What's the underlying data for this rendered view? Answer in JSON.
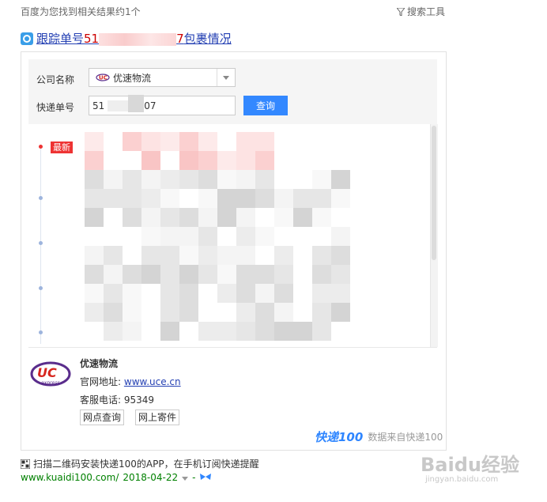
{
  "header": {
    "result_count": "百度为您找到相关结果约1个",
    "search_tools": "搜索工具"
  },
  "result": {
    "title_prefix": "跟踪单号",
    "title_number_start": "51",
    "title_number_end": "7",
    "title_suffix": "包裹情况"
  },
  "form": {
    "company_label": "公司名称",
    "company_value": "优速物流",
    "tracking_label": "快递单号",
    "tracking_start": "51",
    "tracking_end": "07",
    "query_button": "查询"
  },
  "timeline": {
    "latest_badge": "最新"
  },
  "company": {
    "name": "优速物流",
    "website_label": "官网地址:",
    "website": "www.uce.cn",
    "phone_label": "客服电话:",
    "phone": "95349",
    "branch_button": "网点查询",
    "ship_button": "网上寄件",
    "logo_text": "UC",
    "logo_sub": "express"
  },
  "footer": {
    "brand_logo": "快递100",
    "data_source": "数据来自快递100",
    "qr_tip": "扫描二维码安装快递100的APP，在手机订阅快递提醒",
    "url": "www.kuaidi100.com/",
    "date": "2018-04-22",
    "separator": "-"
  },
  "watermark": {
    "text": "Baidu经验",
    "sub": "jingyan.baidu.com"
  },
  "colors": {
    "link": "#2440b3",
    "accent_blue": "#3388ff",
    "badge_red": "#e33333",
    "url_green": "#008000"
  }
}
